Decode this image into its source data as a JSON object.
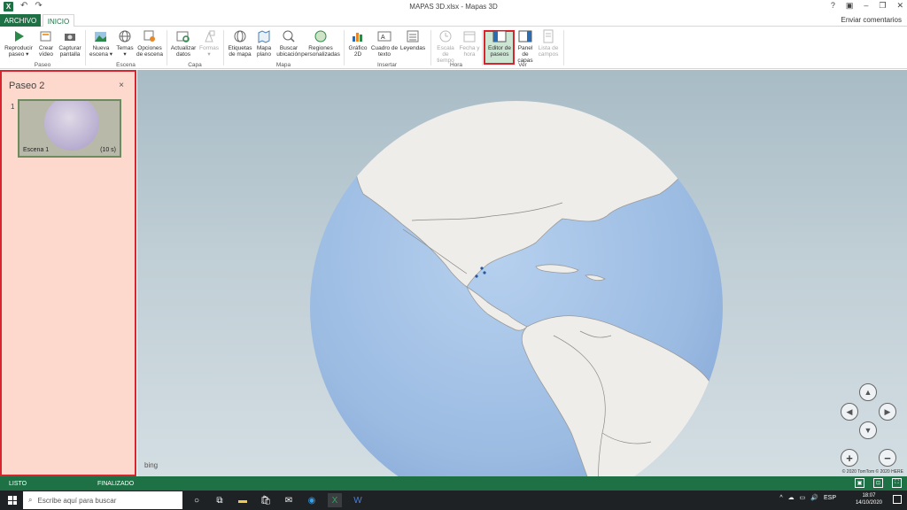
{
  "window": {
    "title": "MAPAS 3D.xlsx - Mapas 3D",
    "app_icon": "X",
    "controls": [
      "?",
      "▣",
      "–",
      "❐",
      "✕"
    ]
  },
  "tabs": {
    "archivo": "ARCHIVO",
    "inicio": "INICIO",
    "feedback": "Enviar comentarios"
  },
  "ribbon": {
    "buttons": [
      {
        "label": "Reproducir paseo ▾",
        "icon": "play-icon"
      },
      {
        "label": "Crear vídeo",
        "icon": "video-icon"
      },
      {
        "label": "Capturar pantalla",
        "icon": "camera-icon"
      },
      {
        "label": "Nueva escena ▾",
        "icon": "new-scene-icon"
      },
      {
        "label": "Temas ▾",
        "icon": "globe-theme-icon"
      },
      {
        "label": "Opciones de escena",
        "icon": "scene-options-icon"
      },
      {
        "label": "Actualizar datos",
        "icon": "refresh-data-icon"
      },
      {
        "label": "Formas ▾",
        "icon": "shapes-icon",
        "disabled": true
      },
      {
        "label": "Etiquetas de mapa",
        "icon": "map-labels-icon"
      },
      {
        "label": "Mapa plano",
        "icon": "flat-map-icon"
      },
      {
        "label": "Buscar ubicación",
        "icon": "find-location-icon"
      },
      {
        "label": "Regiones personalizadas",
        "icon": "custom-regions-icon"
      },
      {
        "label": "Gráfico 2D",
        "icon": "chart-2d-icon"
      },
      {
        "label": "Cuadro de texto",
        "icon": "text-box-icon"
      },
      {
        "label": "Leyendas",
        "icon": "legend-icon"
      },
      {
        "label": "Escala de tiempo",
        "icon": "timeline-icon",
        "disabled": true
      },
      {
        "label": "Fecha y hora",
        "icon": "date-time-icon",
        "disabled": true
      },
      {
        "label": "Editor de paseos",
        "icon": "tour-editor-icon",
        "selected": true
      },
      {
        "label": "Panel de capas",
        "icon": "layer-pane-icon"
      },
      {
        "label": "Lista de campos",
        "icon": "field-list-icon",
        "disabled": true
      }
    ],
    "groups": [
      "Paseo",
      "Escena",
      "Capa",
      "Mapa",
      "Insertar",
      "Hora",
      "Ver"
    ]
  },
  "tour_panel": {
    "title": "Paseo 2",
    "close": "×",
    "scenes": [
      {
        "number": "1",
        "name": "Escena 1",
        "duration": "(10 s)"
      }
    ]
  },
  "map": {
    "bing_label": "bing",
    "copyright": "© 2020 TomTom © 2020 HERE",
    "nav": {
      "up": "▲",
      "left": "◀",
      "right": "▶",
      "down": "▼"
    },
    "zoom": {
      "in": "+",
      "out": "−"
    }
  },
  "status": {
    "left": "LISTO",
    "middle": "FINALIZADO"
  },
  "taskbar": {
    "search_placeholder": "Escribe aquí para buscar",
    "lang": "ESP",
    "time": "18:07",
    "date": "14/10/2020"
  },
  "colors": {
    "excel_green": "#1e7145",
    "highlight_red": "#d9232d",
    "panel_bg": "#fcd9cc",
    "ocean": "#a6c3e6",
    "land": "#eeede9"
  }
}
